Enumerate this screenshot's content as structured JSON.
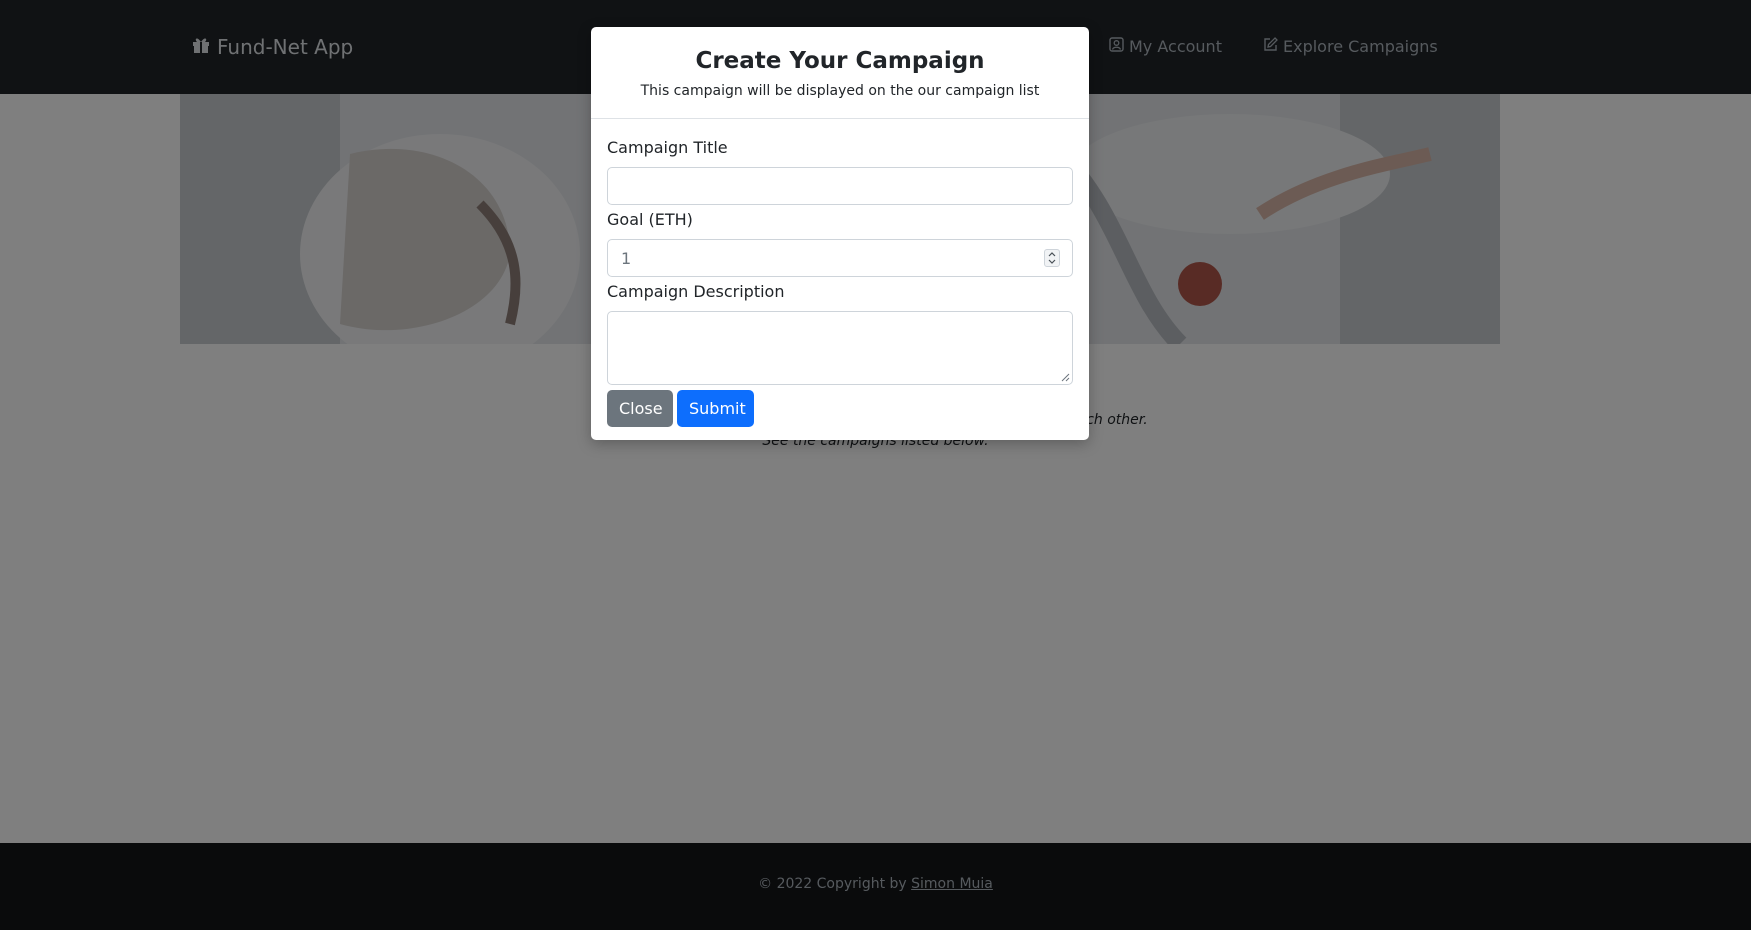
{
  "navbar": {
    "brand": "Fund-Net App",
    "links": [
      {
        "label": "My Account",
        "icon": "person-badge-icon"
      },
      {
        "label": "Explore Campaigns",
        "icon": "pencil-square-icon"
      }
    ]
  },
  "intro": {
    "line1": "Our main purpose is to empower a community where people help each other.",
    "line2": "See the campaigns listed below."
  },
  "modal": {
    "title": "Create Your Campaign",
    "subtitle": "This campaign will be displayed on the our campaign list",
    "fields": {
      "title_label": "Campaign Title",
      "title_value": "",
      "goal_label": "Goal (ETH)",
      "goal_value": "1",
      "description_label": "Campaign Description",
      "description_value": ""
    },
    "buttons": {
      "close": "Close",
      "submit": "Submit"
    }
  },
  "footer": {
    "prefix": "© 2022 Copyright by ",
    "author": "Simon Muia"
  },
  "colors": {
    "navbar": "#212529",
    "footer": "#141619",
    "primary": "#0d6efd",
    "secondary": "#6c757d"
  }
}
